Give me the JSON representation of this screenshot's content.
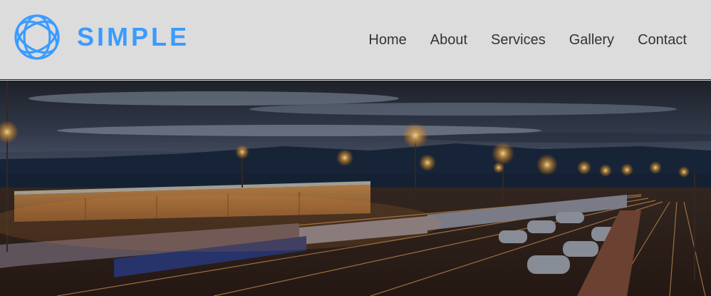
{
  "brand": {
    "name": "SIMPLE",
    "logo_icon": "interlaced-circles-logo-icon",
    "color": "#3a9bff"
  },
  "nav": {
    "items": [
      {
        "label": "Home"
      },
      {
        "label": "About"
      },
      {
        "label": "Services"
      },
      {
        "label": "Gallery"
      },
      {
        "label": "Contact"
      }
    ]
  },
  "hero": {
    "image": "rail-freight-yard-at-dusk"
  },
  "colors": {
    "header_bg": "#dcdcdc",
    "nav_text": "#333333",
    "accent": "#3a9bff"
  }
}
